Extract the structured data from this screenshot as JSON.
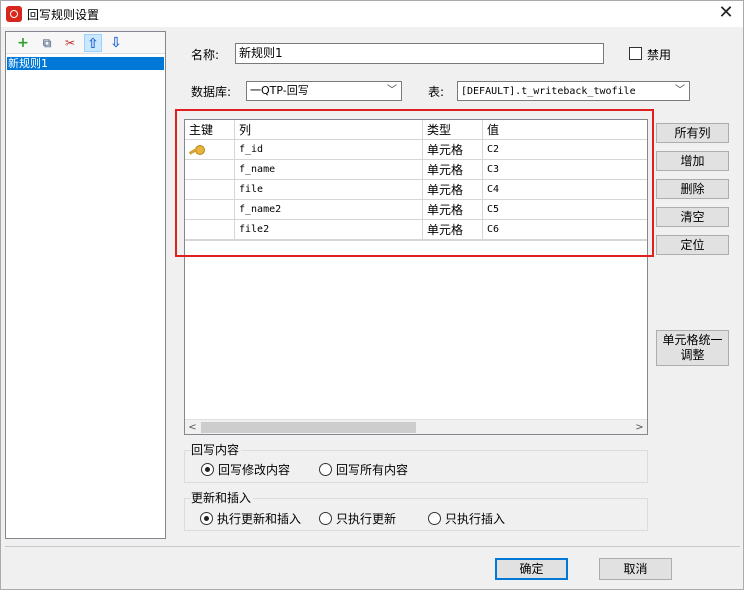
{
  "window": {
    "title": "回写规则设置"
  },
  "toolbar": {
    "add": "+",
    "copy": "⧉",
    "delete": "✂",
    "up": "⇧",
    "down": "⇩"
  },
  "rules": [
    "新规则1"
  ],
  "form": {
    "name_label": "名称:",
    "name_value": "新规则1",
    "disable_label": "禁用",
    "db_label": "数据库:",
    "db_value": "一QTP-回写",
    "table_label": "表:",
    "table_value": "[DEFAULT].t_writeback_twofile"
  },
  "grid": {
    "headers": [
      "主键",
      "列",
      "类型",
      "值"
    ],
    "rows": [
      {
        "key": true,
        "column": "f_id",
        "type": "单元格",
        "value": "C2"
      },
      {
        "key": false,
        "column": "f_name",
        "type": "单元格",
        "value": "C3"
      },
      {
        "key": false,
        "column": "file",
        "type": "单元格",
        "value": "C4"
      },
      {
        "key": false,
        "column": "f_name2",
        "type": "单元格",
        "value": "C5"
      },
      {
        "key": false,
        "column": "file2",
        "type": "单元格",
        "value": "C6"
      }
    ]
  },
  "side_buttons": {
    "all_columns": "所有列",
    "add": "增加",
    "delete": "删除",
    "clear": "清空",
    "locate": "定位",
    "unify_line1": "单元格统一",
    "unify_line2": "调整"
  },
  "writeback_group": {
    "title": "回写内容",
    "option1": "回写修改内容",
    "option2": "回写所有内容",
    "selected": "回写修改内容"
  },
  "update_group": {
    "title": "更新和插入",
    "option1": "执行更新和插入",
    "option2": "只执行更新",
    "option3": "只执行插入",
    "selected": "执行更新和插入"
  },
  "footer": {
    "ok": "确定",
    "cancel": "取消"
  },
  "colors": {
    "accent": "#0078d7",
    "highlight_border": "#e02020",
    "app_icon": "#d9261c"
  }
}
